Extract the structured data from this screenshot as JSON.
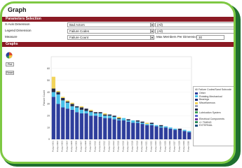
{
  "app": {
    "title": "Graph"
  },
  "sections": {
    "parameters": "Parameters Selection",
    "graphs": "Graphs"
  },
  "params": {
    "x_axis_label": "X-Axis Dimension",
    "x_axis_value": "Bad Actors",
    "x_axis_filter": "(All)",
    "legend_label": "Legend Dimension",
    "legend_value": "Failure Codes",
    "legend_filter": "(All)",
    "measure_label": "Measure",
    "measure_value": "Failure Count",
    "max_members_label": "Max Members Per Dimension",
    "max_members_value": "30"
  },
  "buttons": {
    "plot": "Plot",
    "reset": "Reset"
  },
  "colors": {
    "frame": "#7ec843",
    "section": "#8b1a24",
    "series_main": "#2e3e9c",
    "series_light": "#48c0e8",
    "series_yellow": "#f2d45a",
    "series_dark": "#252a46"
  },
  "legend": {
    "title": "All Failure Codes/Sand Subcode",
    "items": [
      {
        "label": "Other",
        "color": "#2e3e9c"
      },
      {
        "label": "Rotating Mechanical",
        "color": "#48c0e8"
      },
      {
        "label": "Bearings",
        "color": "#1d2f7c"
      },
      {
        "label": "Miscellaneous",
        "color": "#f2d45a"
      },
      {
        "label": "",
        "color": "#9aa0b8"
      },
      {
        "label": "",
        "color": "#252a46"
      },
      {
        "label": "Lubrication System",
        "color": "#3a9c54"
      },
      {
        "label": "",
        "color": "#5b6bd0"
      },
      {
        "label": "Electrical Components",
        "color": "#6d3aa0"
      },
      {
        "label": "4 / TIMING",
        "color": "#2a8a5a"
      },
      {
        "label": "EXTERNAL",
        "color": "#1e5080"
      }
    ]
  },
  "chart_data": {
    "type": "bar",
    "stacked": true,
    "ylabel": "Failure Count",
    "ylim": [
      0,
      70
    ],
    "yticks": [
      0,
      10,
      20,
      30,
      40,
      50,
      60
    ],
    "categories": [
      "Pump-0001",
      "Pump-0002",
      "Pump-0003",
      "Pump-0004",
      "Pump-0005",
      "Pump-0006",
      "Pump-0007",
      "Pump-0008",
      "Pump-0009",
      "Pump-0010",
      "Pump-0011",
      "Pump-0012",
      "Pump-0013",
      "Pump-0014",
      "Pump-0015",
      "Pump-0016",
      "Pump-0017",
      "Pump-0018",
      "Pump-0019",
      "Pump-0020",
      "Pump-0021",
      "Pump-0022",
      "Pump-0023",
      "Pump-0024",
      "Pump-0025",
      "Pump-0026",
      "Pump-0027",
      "Pump-0028",
      "Pump-0029",
      "Pump-0030"
    ],
    "series": [
      {
        "name": "Other",
        "color": "#2e3e9c",
        "values": [
          36,
          30,
          27,
          26,
          25,
          23,
          22,
          22,
          20,
          20,
          19,
          18,
          18,
          17,
          16,
          16,
          15,
          14,
          14,
          13,
          12,
          12,
          11,
          10,
          10,
          9,
          8,
          8,
          7,
          6
        ]
      },
      {
        "name": "Rotating Mechanical",
        "color": "#48c0e8",
        "values": [
          4,
          8,
          6,
          5,
          3,
          4,
          3,
          2,
          3,
          2,
          3,
          2,
          2,
          2,
          1,
          2,
          1,
          2,
          1,
          1,
          1,
          1,
          1,
          1,
          1,
          1,
          1,
          0,
          1,
          1
        ]
      },
      {
        "name": "Bearings",
        "color": "#252a46",
        "values": [
          3,
          2,
          2,
          1,
          2,
          1,
          2,
          2,
          1,
          1,
          1,
          1,
          1,
          1,
          1,
          0,
          1,
          0,
          1,
          1,
          0,
          1,
          0,
          1,
          0,
          0,
          0,
          1,
          0,
          0
        ]
      },
      {
        "name": "Miscellaneous",
        "color": "#f2d45a",
        "values": [
          10,
          1,
          1,
          1,
          1,
          0,
          1,
          0,
          1,
          0,
          0,
          1,
          0,
          0,
          1,
          0,
          0,
          0,
          0,
          0,
          1,
          0,
          0,
          0,
          0,
          0,
          0,
          0,
          0,
          0
        ]
      }
    ]
  }
}
